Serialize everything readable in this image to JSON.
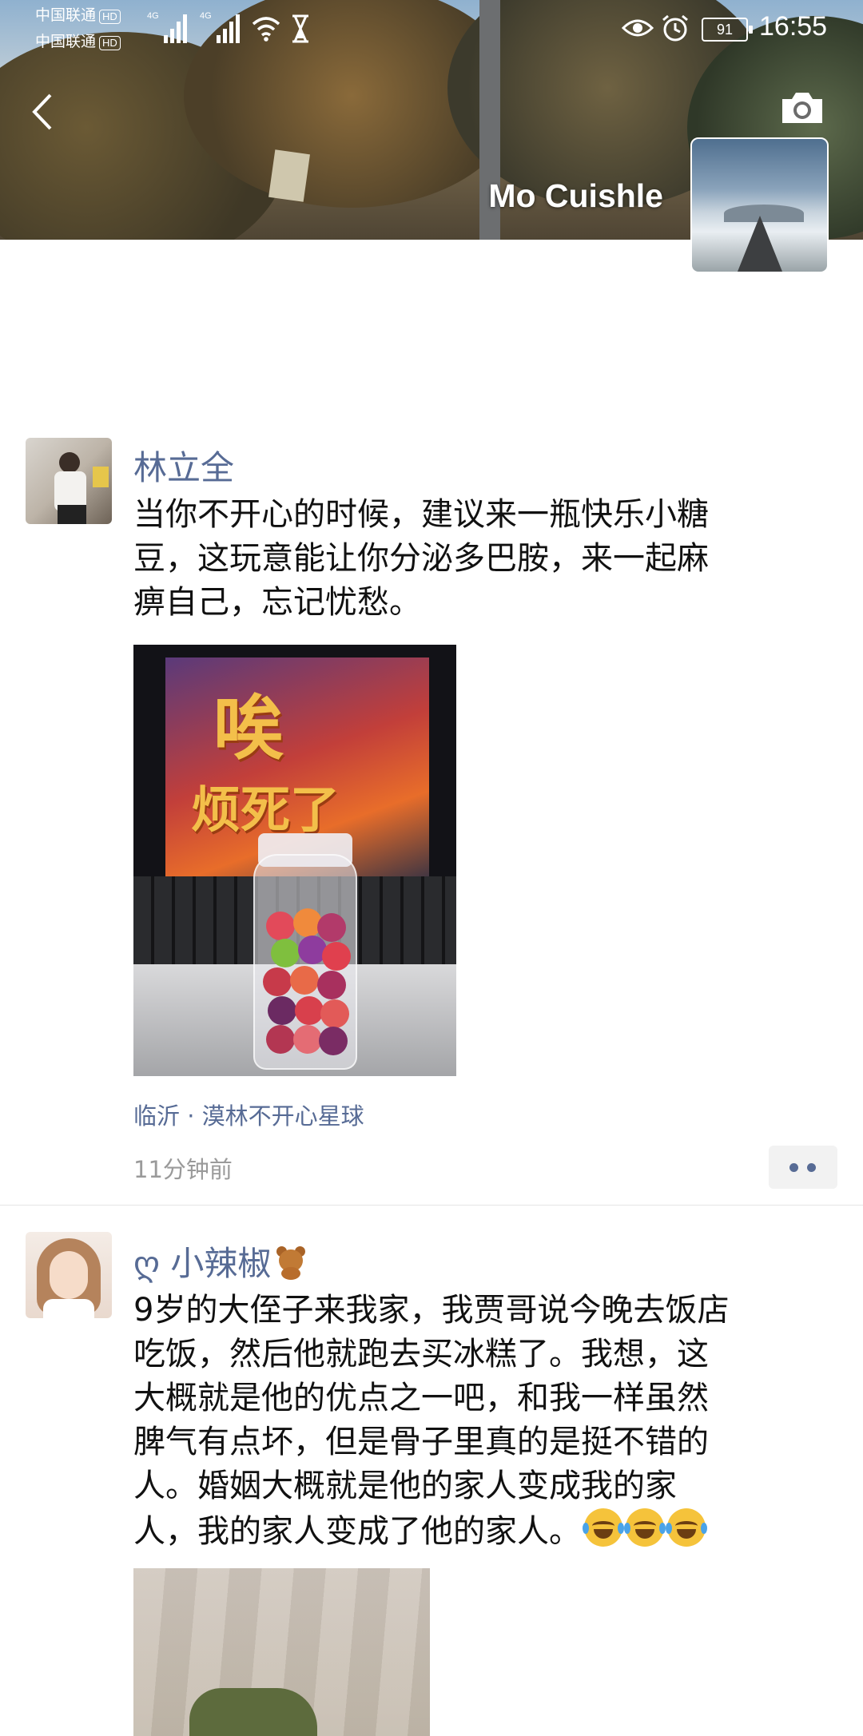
{
  "status_bar": {
    "carrier1": "中国联通",
    "carrier2": "中国联通",
    "hd_label": "HD",
    "net1": "4G",
    "net2": "4G",
    "battery": "91",
    "time": "16:55"
  },
  "profile": {
    "username": "Mo Cuishle"
  },
  "posts": [
    {
      "author": "林立全",
      "text_lines": [
        "当你不开心的时候，建议来一瓶快乐小糖",
        "豆，这玩意能让你分泌多巴胺，来一起麻",
        "痹自己，忘记忧愁。"
      ],
      "image_caption_1": "唉",
      "image_caption_2": "烦死了",
      "location": "临沂 · 漠林不开心星球",
      "time": "11分钟前"
    },
    {
      "author": "ღ 小辣椒",
      "text_lines": [
        "9岁的大侄子来我家，我贾哥说今晚去饭店",
        "吃饭，然后他就跑去买冰糕了。我想，这",
        "大概就是他的优点之一吧，和我一样虽然",
        "脾气有点坏，但是骨子里真的是挺不错的",
        "人。婚姻大概就是他的家人变成我的家",
        "人，我的家人变成了他的家人。"
      ]
    }
  ],
  "colors": {
    "name_link": "#576b95",
    "text": "#111111",
    "meta": "#9a9a9a"
  }
}
